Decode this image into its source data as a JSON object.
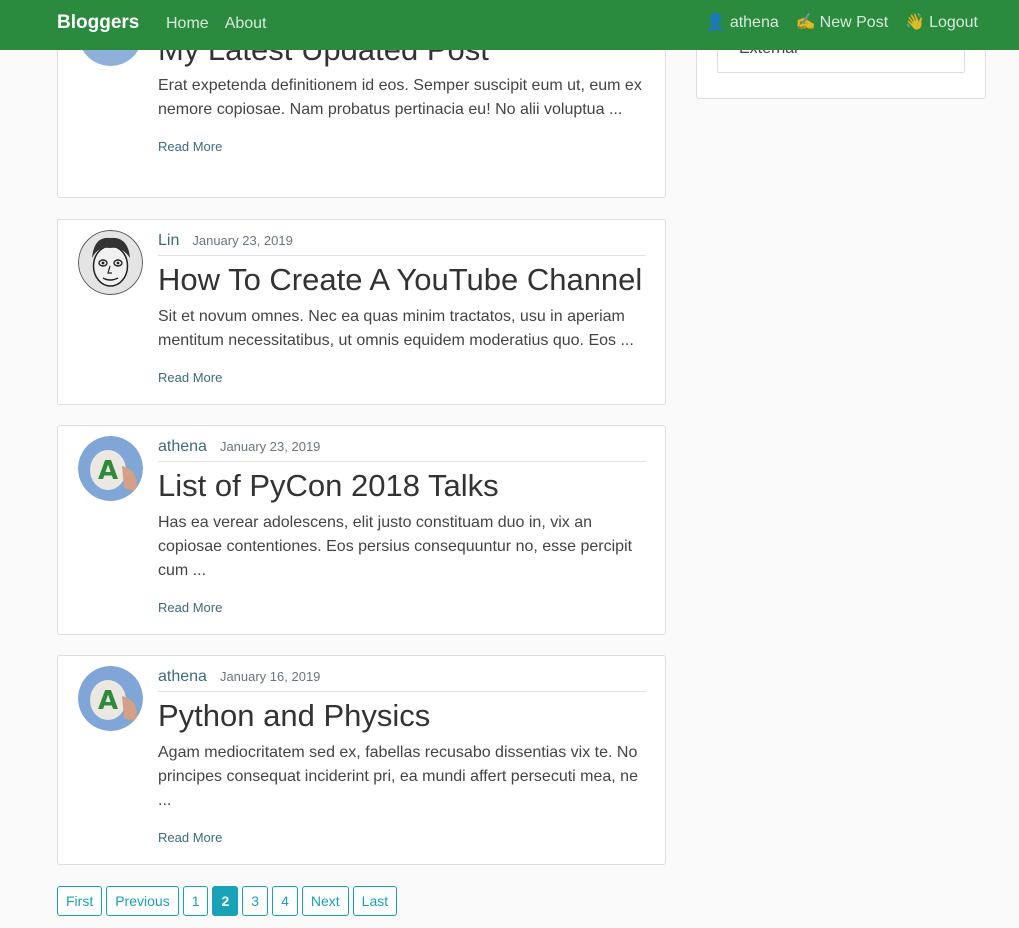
{
  "navbar": {
    "brand": "Bloggers",
    "links": [
      {
        "label": "Home"
      },
      {
        "label": "About"
      }
    ],
    "user_label": "athena",
    "new_post_label": "New Post",
    "logout_label": "Logout"
  },
  "sidebar": {
    "items": [
      {
        "label": "External"
      }
    ]
  },
  "posts": [
    {
      "title": "My Latest Updated Post",
      "excerpt": "Erat expetenda definitionem id eos. Semper suscipit eum ut, eum ex nemore copiosae. Nam probatus pertinacia eu! No alii voluptua ...",
      "read_more": "Read More"
    },
    {
      "author": "Lin",
      "date": "January 23, 2019",
      "title": "How To Create A YouTube Channel",
      "excerpt": "Sit et novum omnes. Nec ea quas minim tractatos, usu in aperiam mentitum necessitatibus, ut omnis equidem moderatius quo. Eos ...",
      "read_more": "Read More"
    },
    {
      "author": "athena",
      "date": "January 23, 2019",
      "title": "List of PyCon 2018 Talks",
      "excerpt": "Has ea verear adolescens, elit justo constituam duo in, vix an copiosae contentiones. Eos persius consequuntur no, esse percipit cum ...",
      "read_more": "Read More"
    },
    {
      "author": "athena",
      "date": "January 16, 2019",
      "title": "Python and Physics",
      "excerpt": "Agam mediocritatem sed ex, fabellas recusabo dissentias vix te. No principes consequat inciderint pri, ea mundi affert persecuti mea, ne ...",
      "read_more": "Read More"
    }
  ],
  "pagination": {
    "first": "First",
    "previous": "Previous",
    "pages": [
      "1",
      "2",
      "3",
      "4"
    ],
    "next": "Next",
    "last": "Last"
  },
  "colors": {
    "navbar": "#2a8a3e",
    "page_accent": "#17a2b8",
    "link": "#3d6b7d"
  },
  "icons": {
    "user": "bust-in-silhouette-icon",
    "new_post": "writing-hand-icon",
    "logout": "waving-hand-icon"
  }
}
